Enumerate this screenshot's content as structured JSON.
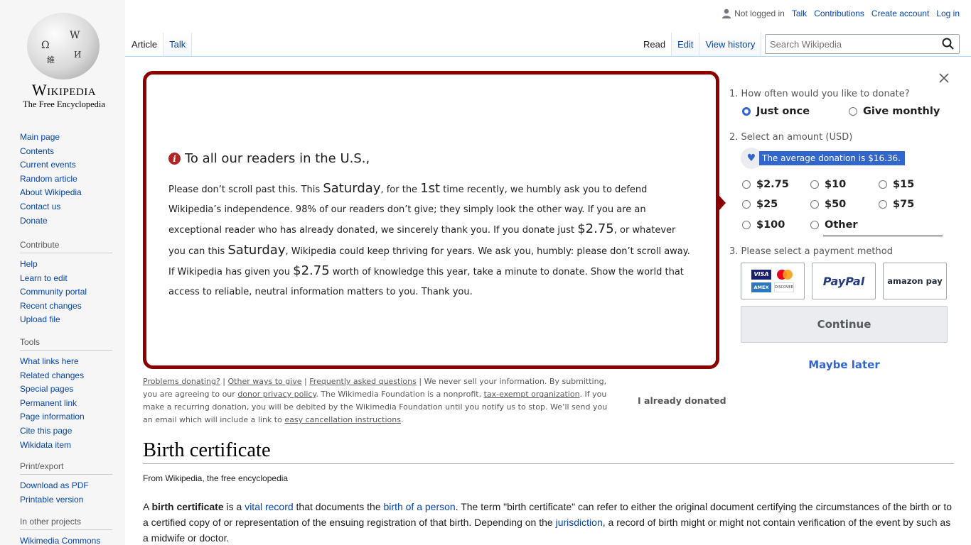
{
  "logo": {
    "wordmark": "Wikipedia",
    "tagline": "The Free Encyclopedia"
  },
  "header": {
    "not_logged_in": "Not logged in",
    "links": [
      "Talk",
      "Contributions",
      "Create account",
      "Log in"
    ],
    "tabs_left": [
      "Article",
      "Talk"
    ],
    "tabs_right": [
      "Read",
      "Edit",
      "View history"
    ],
    "search_placeholder": "Search Wikipedia"
  },
  "sidebar": {
    "main": [
      "Main page",
      "Contents",
      "Current events",
      "Random article",
      "About Wikipedia",
      "Contact us",
      "Donate"
    ],
    "contribute_title": "Contribute",
    "contribute": [
      "Help",
      "Learn to edit",
      "Community portal",
      "Recent changes",
      "Upload file"
    ],
    "tools_title": "Tools",
    "tools": [
      "What links here",
      "Related changes",
      "Special pages",
      "Permanent link",
      "Page information",
      "Cite this page",
      "Wikidata item"
    ],
    "print_title": "Print/export",
    "print": [
      "Download as PDF",
      "Printable version"
    ],
    "projects_title": "In other projects",
    "projects": [
      "Wikimedia Commons"
    ]
  },
  "banner": {
    "headline": "To all our readers in the U.S.,",
    "p1": "Please don’t scroll past this. This ",
    "day1": "Saturday",
    "p2": ", for the ",
    "nth": "1st",
    "p3": " time recently, we humbly ask you to defend Wikipedia’s independence. 98% of our readers don’t give; they simply look the other way. If you are an exceptional reader who has already donated, we sincerely thank you. If you donate just ",
    "amt1": "$2.75",
    "p4": ", or whatever you can this ",
    "day2": "Saturday",
    "p5": ", Wikipedia could keep thriving for years. We ask you, humbly: please don’t scroll away. If Wikipedia has given you ",
    "amt2": "$2.75",
    "p6": " worth of knowledge this year, take a minute to donate. Show the world that access to reliable, neutral information matters to you. Thank you."
  },
  "footnote": {
    "problems": "Problems donating?",
    "sep1": " | ",
    "other_ways": "Other ways to give",
    "sep2": " | ",
    "faq": "Frequently asked questions",
    "t1": " | We never sell your information. By submitting, you are agreeing to our ",
    "privacy": "donor privacy policy",
    "t2": ". The Wikimedia Foundation is a nonprofit, ",
    "tax": "tax-exempt organization",
    "t3": ". If you make a recurring donation, you will be debited by the Wikimedia Foundation until you notify us to stop. We’ll send you an email which will include a link to ",
    "cancel": "easy cancellation instructions",
    "t4": "."
  },
  "already_donated": "I already donated",
  "donate": {
    "step1": "1.  How often would you like to donate?",
    "once": "Just once",
    "monthly": "Give monthly",
    "step2": "2.  Select an amount (USD)",
    "average": "The average donation is $16.36.",
    "amounts": [
      "$2.75",
      "$10",
      "$15",
      "$25",
      "$50",
      "$75",
      "$100",
      "Other"
    ],
    "step3": "3.  Please select a payment method",
    "paypal": "PayPal",
    "amazon": "amazon pay",
    "card_visa": "VISA",
    "card_amex": "AMEX",
    "card_discover": "DISCOVER",
    "continue": "Continue",
    "later": "Maybe later"
  },
  "article": {
    "title": "Birth certificate",
    "from": "From Wikipedia, the free encyclopedia",
    "l1": "A ",
    "bold": "birth certificate",
    "l2": " is a ",
    "link1": "vital record",
    "l3": " that documents the ",
    "link2": "birth of a person",
    "l4": ". The term \"birth certificate\" can refer to either the original document certifying the circumstances of the birth or to a certified copy of or representation of the ensuing registration of that birth. Depending on the ",
    "link3": "jurisdiction",
    "l5": ", a record of birth might or might not contain verification of the event by such as a midwife or doctor."
  },
  "colors": {
    "link": "#0645ad",
    "accent": "#3366cc",
    "banner_border": "#8b0000"
  }
}
